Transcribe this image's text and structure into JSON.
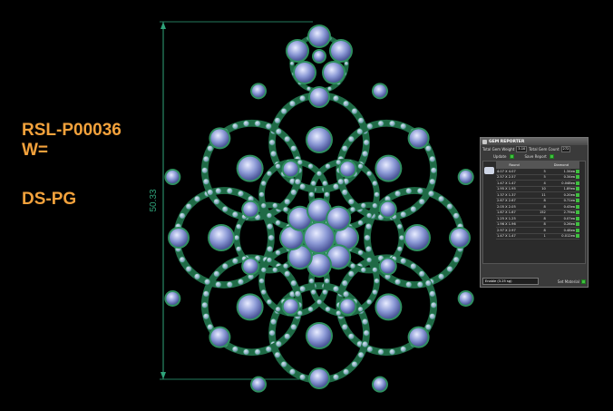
{
  "product": {
    "code": "RSL-P00036",
    "weight_label": "W=",
    "type": "DS-PG"
  },
  "dimension": {
    "height_label": "50.33"
  },
  "gem_reporter": {
    "title": "GEM REPORTER",
    "total_weight_label": "Total Gem Weight",
    "total_weight_value": "3.10",
    "total_count_label": "Total Gem Count",
    "total_count_value": "272",
    "update_label": "Update",
    "save_report_label": "Save Report",
    "columns": [
      "Round",
      "",
      "Diamond"
    ],
    "rows": [
      {
        "size": "4.07 X 4.07",
        "count": "5",
        "weight": "1.34ea"
      },
      {
        "size": "2.57 X 2.57",
        "count": "5",
        "weight": "0.34ea"
      },
      {
        "size": "1.47 X 1.47",
        "count": "4",
        "weight": "0.048ea"
      },
      {
        "size": "1.95 X 1.95",
        "count": "10",
        "weight": "1.89ea"
      },
      {
        "size": "1.37 X 1.37",
        "count": "11",
        "weight": "0.20ea"
      },
      {
        "size": "2.67 X 2.67",
        "count": "8",
        "weight": "0.71ea"
      },
      {
        "size": "2.05 X 2.05",
        "count": "8",
        "weight": "0.43ea"
      },
      {
        "size": "1.67 X 1.67",
        "count": "152",
        "weight": "2.79ea"
      },
      {
        "size": "1.25 X 1.25",
        "count": "8",
        "weight": "0.07ea"
      },
      {
        "size": "1.96 X 1.96",
        "count": "8",
        "weight": "0.26ea"
      },
      {
        "size": "2.97 X 2.97",
        "count": "8",
        "weight": "0.48ea"
      },
      {
        "size": "1.47 X 1.47",
        "count": "1",
        "weight": "0.012ea"
      }
    ],
    "unit_select": "Enable    (3.25 sg)",
    "set_material_label": "Set Material"
  },
  "colors": {
    "label": "#f3a23c",
    "metal": "#2f8f5f",
    "gem": "#8c9ad6",
    "dim_line": "#2fa37a"
  }
}
